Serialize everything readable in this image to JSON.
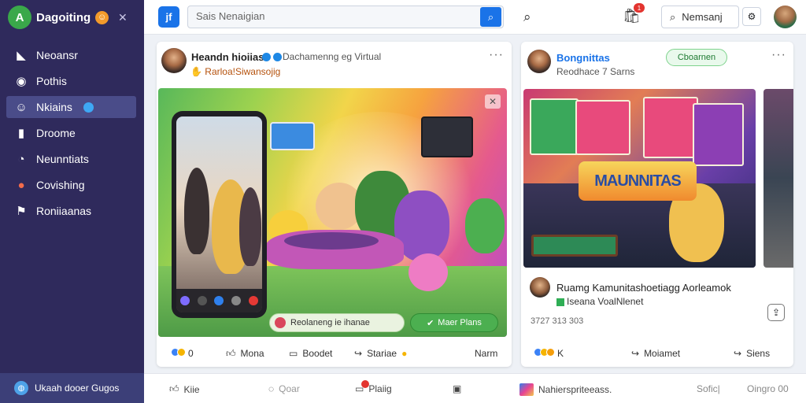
{
  "app": {
    "name": "Dagoiting",
    "badge_icon": "smile-icon"
  },
  "sidebar": {
    "items": [
      {
        "label": "Neoansr",
        "icon": "bookmark-icon",
        "active": false
      },
      {
        "label": "Pothis",
        "icon": "circle-play-icon",
        "active": false
      },
      {
        "label": "Nkiains",
        "icon": "message-icon",
        "active": true
      },
      {
        "label": "Droome",
        "icon": "bar-chart-icon",
        "active": false
      },
      {
        "label": "Neunntiats",
        "icon": "clock-icon",
        "active": false
      },
      {
        "label": "Covishing",
        "icon": "red-circle-icon",
        "active": false
      },
      {
        "label": "Roniiaanas",
        "icon": "flag-icon",
        "active": false
      }
    ],
    "footer": "Ukaah dooer Gugos"
  },
  "topbar": {
    "app_icon_text": "jf",
    "search_placeholder": "Sais Nenaigian",
    "cart_count": "1",
    "right_search": "Nemsanj"
  },
  "post1": {
    "author": "Heandn hioiias",
    "meta": "Dachamenng eg Virtual",
    "tag": "Rarloa!Siwansojig",
    "pill_left": "Reolaneng ie ihanae",
    "pill_right": "Maer Plans",
    "actions": {
      "reactions": "0",
      "comment": "Mona",
      "share": "Boodet",
      "send": "Stariae",
      "more": "Narm"
    }
  },
  "post2": {
    "author": "Bongnittas",
    "meta": "Reodhace 7 Sarns",
    "follow": "Cboarnen",
    "banner_text": "MAUNNITAS",
    "caption_title": "Ruamg Kamunitashoetiagg Aorleamok",
    "caption_sub": "Iseana VoalNlenet",
    "stats": "3727 313 303",
    "actions": {
      "reactions": "K",
      "comment": "Moiamet",
      "share": "Siens"
    }
  },
  "bottombar": {
    "items": [
      "Kiie",
      "Qoar",
      "Plaiig",
      "",
      "Nahierspriteeass."
    ],
    "right1": "Sofic|",
    "right2": "Oingro 00"
  },
  "colors": {
    "sidebar": "#2f2a5c",
    "accent": "#1a73e8",
    "active_nav": "#4a4c89"
  }
}
